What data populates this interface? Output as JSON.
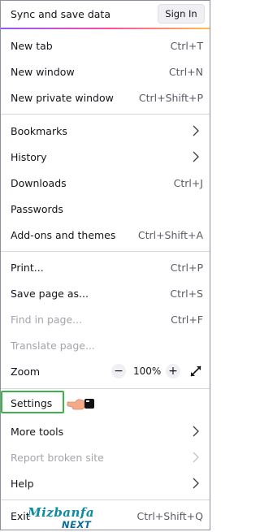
{
  "header": {
    "title": "Sync and save data",
    "signin_label": "Sign In"
  },
  "items": {
    "new_tab": {
      "label": "New tab",
      "shortcut": "Ctrl+T"
    },
    "new_window": {
      "label": "New window",
      "shortcut": "Ctrl+N"
    },
    "new_private": {
      "label": "New private window",
      "shortcut": "Ctrl+Shift+P"
    },
    "bookmarks": {
      "label": "Bookmarks"
    },
    "history": {
      "label": "History"
    },
    "downloads": {
      "label": "Downloads",
      "shortcut": "Ctrl+J"
    },
    "passwords": {
      "label": "Passwords"
    },
    "addons": {
      "label": "Add-ons and themes",
      "shortcut": "Ctrl+Shift+A"
    },
    "print": {
      "label": "Print...",
      "shortcut": "Ctrl+P"
    },
    "save_page": {
      "label": "Save page as...",
      "shortcut": "Ctrl+S"
    },
    "find": {
      "label": "Find in page...",
      "shortcut": "Ctrl+F"
    },
    "translate": {
      "label": "Translate page..."
    },
    "zoom": {
      "label": "Zoom",
      "minus": "−",
      "value": "100%",
      "plus": "+"
    },
    "settings": {
      "label": "Settings"
    },
    "more_tools": {
      "label": "More tools"
    },
    "report": {
      "label": "Report broken site"
    },
    "help": {
      "label": "Help"
    },
    "exit": {
      "label": "Exit",
      "shortcut": "Ctrl+Shift+Q"
    }
  },
  "watermark": {
    "brand": "Mizbanfa",
    "sub": "NEXT"
  },
  "colors": {
    "accent_start": "#9059ff",
    "accent_end": "#ffbd4f",
    "highlight": "#3cb34a",
    "disabled": "#a4a4ab"
  },
  "icons": {
    "submenu": "chevron-right-icon",
    "fullscreen": "fullscreen-arrows-icon",
    "pointer": "pointing-hand-icon"
  }
}
